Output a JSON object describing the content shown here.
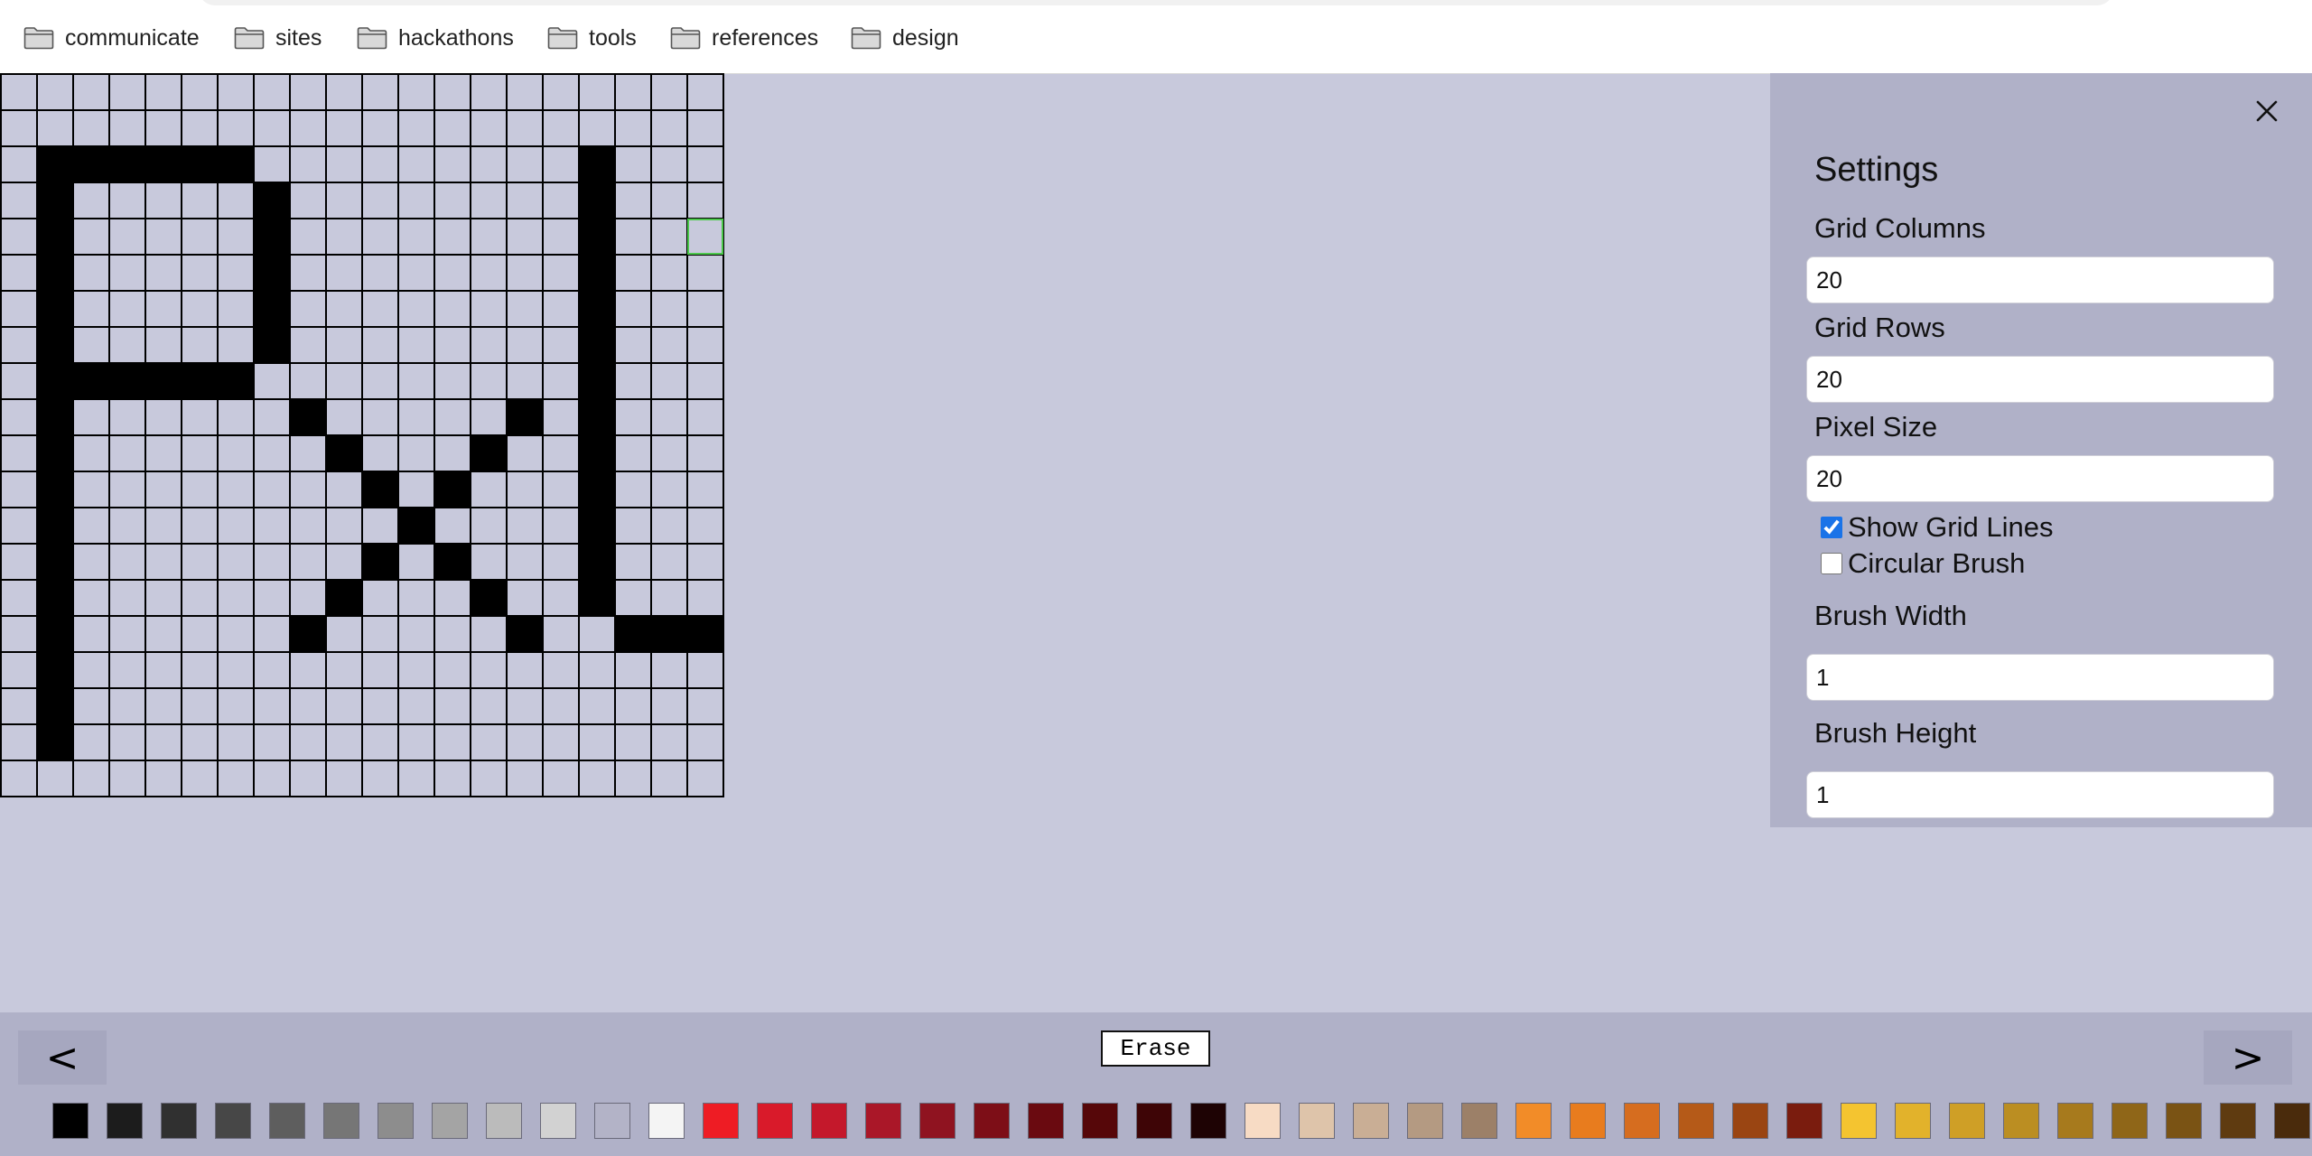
{
  "bookmarks": {
    "items": [
      {
        "label": "communicate",
        "icon": "folder-icon"
      },
      {
        "label": "sites",
        "icon": "folder-icon"
      },
      {
        "label": "hackathons",
        "icon": "folder-icon"
      },
      {
        "label": "tools",
        "icon": "folder-icon"
      },
      {
        "label": "references",
        "icon": "folder-icon"
      },
      {
        "label": "design",
        "icon": "folder-icon"
      }
    ]
  },
  "canvas": {
    "columns": 20,
    "rows": 20,
    "background_color": "#c8c9dc",
    "grid_line_color": "#000000",
    "hover_color": "#4cc84c",
    "hover_cell": [
      19,
      4
    ],
    "filled_color": "#000000",
    "filled_cells": [
      [
        1,
        2
      ],
      [
        2,
        2
      ],
      [
        3,
        2
      ],
      [
        4,
        2
      ],
      [
        5,
        2
      ],
      [
        6,
        2
      ],
      [
        1,
        3
      ],
      [
        1,
        4
      ],
      [
        1,
        5
      ],
      [
        1,
        6
      ],
      [
        1,
        7
      ],
      [
        1,
        8
      ],
      [
        1,
        9
      ],
      [
        1,
        10
      ],
      [
        1,
        11
      ],
      [
        1,
        12
      ],
      [
        1,
        13
      ],
      [
        1,
        14
      ],
      [
        1,
        15
      ],
      [
        1,
        16
      ],
      [
        1,
        17
      ],
      [
        1,
        18
      ],
      [
        7,
        3
      ],
      [
        7,
        4
      ],
      [
        7,
        5
      ],
      [
        7,
        6
      ],
      [
        7,
        7
      ],
      [
        2,
        8
      ],
      [
        3,
        8
      ],
      [
        4,
        8
      ],
      [
        5,
        8
      ],
      [
        6,
        8
      ],
      [
        8,
        9
      ],
      [
        9,
        10
      ],
      [
        10,
        11
      ],
      [
        11,
        12
      ],
      [
        10,
        13
      ],
      [
        9,
        14
      ],
      [
        8,
        15
      ],
      [
        14,
        9
      ],
      [
        13,
        10
      ],
      [
        12,
        11
      ],
      [
        12,
        13
      ],
      [
        13,
        14
      ],
      [
        14,
        15
      ],
      [
        16,
        2
      ],
      [
        16,
        3
      ],
      [
        16,
        4
      ],
      [
        16,
        5
      ],
      [
        16,
        6
      ],
      [
        16,
        7
      ],
      [
        16,
        8
      ],
      [
        16,
        9
      ],
      [
        16,
        10
      ],
      [
        16,
        11
      ],
      [
        16,
        12
      ],
      [
        16,
        13
      ],
      [
        16,
        14
      ],
      [
        17,
        15
      ],
      [
        18,
        15
      ],
      [
        19,
        15
      ]
    ]
  },
  "settings": {
    "title": "Settings",
    "grid_columns_label": "Grid Columns",
    "grid_columns_value": "20",
    "grid_rows_label": "Grid Rows",
    "grid_rows_value": "20",
    "pixel_size_label": "Pixel Size",
    "pixel_size_value": "20",
    "show_grid_lines_label": "Show Grid Lines",
    "show_grid_lines_checked": true,
    "circular_brush_label": "Circular Brush",
    "circular_brush_checked": false,
    "brush_width_label": "Brush Width",
    "brush_width_value": "1",
    "brush_height_label": "Brush Height",
    "brush_height_value": "1"
  },
  "toolbar": {
    "prev_label": "<",
    "next_label": ">",
    "erase_label": "Erase",
    "palette": [
      "#000000",
      "#1c1c1c",
      "#303030",
      "#474747",
      "#5e5e5e",
      "#767676",
      "#8d8d8d",
      "#a4a4a4",
      "#bbbbbb",
      "#d2d2d2",
      "#b3b3c7",
      "#f4f4f4",
      "#ee1c24",
      "#d91a2a",
      "#c4182b",
      "#aa1728",
      "#8f1320",
      "#7d0e17",
      "#6a0a10",
      "#560709",
      "#3e0506",
      "#1e0304",
      "#f7dbc4",
      "#dec4aa",
      "#c9ae95",
      "#b49a82",
      "#9c8068",
      "#f28c28",
      "#e87c1e",
      "#d66d1f",
      "#b55a18",
      "#9a4512",
      "#7a1c0e",
      "#f4c430",
      "#e2b22b",
      "#cf9f26",
      "#bb8e22",
      "#a77a1d",
      "#8f6618",
      "#7a5314",
      "#5f3b10",
      "#4a2b0c"
    ]
  }
}
